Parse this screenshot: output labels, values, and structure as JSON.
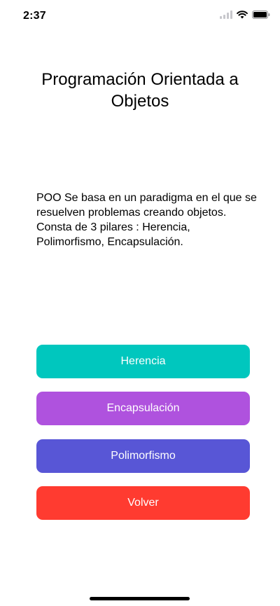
{
  "status_bar": {
    "time": "2:37"
  },
  "title": "Programación Orientada a Objetos",
  "description": "POO Se basa en un paradigma en el que se resuelven problemas creando objetos. Consta de 3 pilares : Herencia, Polimorfismo, Encapsulación.",
  "buttons": [
    {
      "label": "Herencia",
      "color": "#00c7be"
    },
    {
      "label": "Encapsulación",
      "color": "#af52de"
    },
    {
      "label": "Polimorfismo",
      "color": "#5856d6"
    },
    {
      "label": "Volver",
      "color": "#ff3b30"
    }
  ],
  "icons": {
    "signal": "cellular-signal-icon",
    "wifi": "wifi-icon",
    "battery": "battery-icon"
  }
}
